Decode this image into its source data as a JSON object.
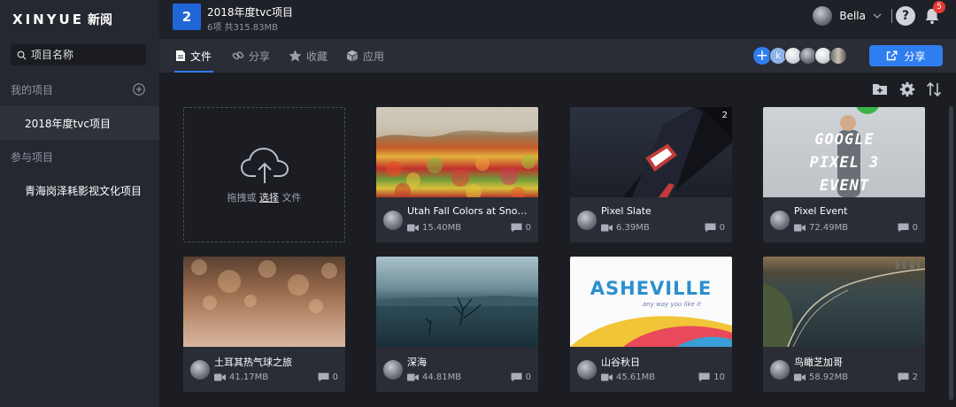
{
  "brand": {
    "name": "XINYUE",
    "suffix": "新阅"
  },
  "sidebar": {
    "search_placeholder": "项目名称",
    "my_projects_label": "我的项目",
    "my_projects": [
      {
        "label": "2018年度tvc项目",
        "active": true
      }
    ],
    "joined_label": "参与项目",
    "joined_projects": [
      {
        "label": "青海岗泽耗影视文化项目"
      }
    ]
  },
  "header": {
    "project_badge": "2",
    "project_title": "2018年度tvc项目",
    "project_meta": "6项 共315.83MB",
    "user_name": "Bella",
    "help_icon": "help-circle-icon",
    "notifications": "5"
  },
  "tabs": [
    {
      "label": "文件",
      "icon": "file-icon",
      "active": true
    },
    {
      "label": "分享",
      "icon": "link-icon"
    },
    {
      "label": "收藏",
      "icon": "star-icon"
    },
    {
      "label": "应用",
      "icon": "cube-icon"
    }
  ],
  "members": {
    "add": "+",
    "initials": [
      "k"
    ]
  },
  "share_button": "分享",
  "toolbar": [
    "add-folder-icon",
    "settings-icon",
    "sort-icon"
  ],
  "upload": {
    "prefix": "拖拽或",
    "action": "选择",
    "suffix": "文件"
  },
  "files": [
    {
      "title": "Utah Fall Colors at Snowb...",
      "size": "15.40MB",
      "comments": "0",
      "thumb": "autumn-forest"
    },
    {
      "title": "Pixel Slate",
      "size": "6.39MB",
      "comments": "0",
      "thumb": "device",
      "version": "2"
    },
    {
      "title": "Pixel Event",
      "size": "72.49MB",
      "comments": "0",
      "thumb": "keynote",
      "thumb_text": "GOOGLE PIXEL 3 EVENT"
    },
    {
      "title": "土耳其热气球之旅",
      "size": "41.17MB",
      "comments": "0",
      "thumb": "bokeh"
    },
    {
      "title": "深海",
      "size": "44.81MB",
      "comments": "0",
      "thumb": "lake"
    },
    {
      "title": "山谷秋日",
      "size": "45.61MB",
      "comments": "10",
      "thumb": "asheville",
      "thumb_text": "ASHEVILLE",
      "thumb_sub": "any way you like it"
    },
    {
      "title": "鸟瞰芝加哥",
      "size": "58.92MB",
      "comments": "2",
      "thumb": "aerial"
    }
  ],
  "colors": {
    "accent": "#2f7ef0",
    "bg": "#1b1d22",
    "sidebar": "#252830",
    "badge": "#e53935"
  }
}
